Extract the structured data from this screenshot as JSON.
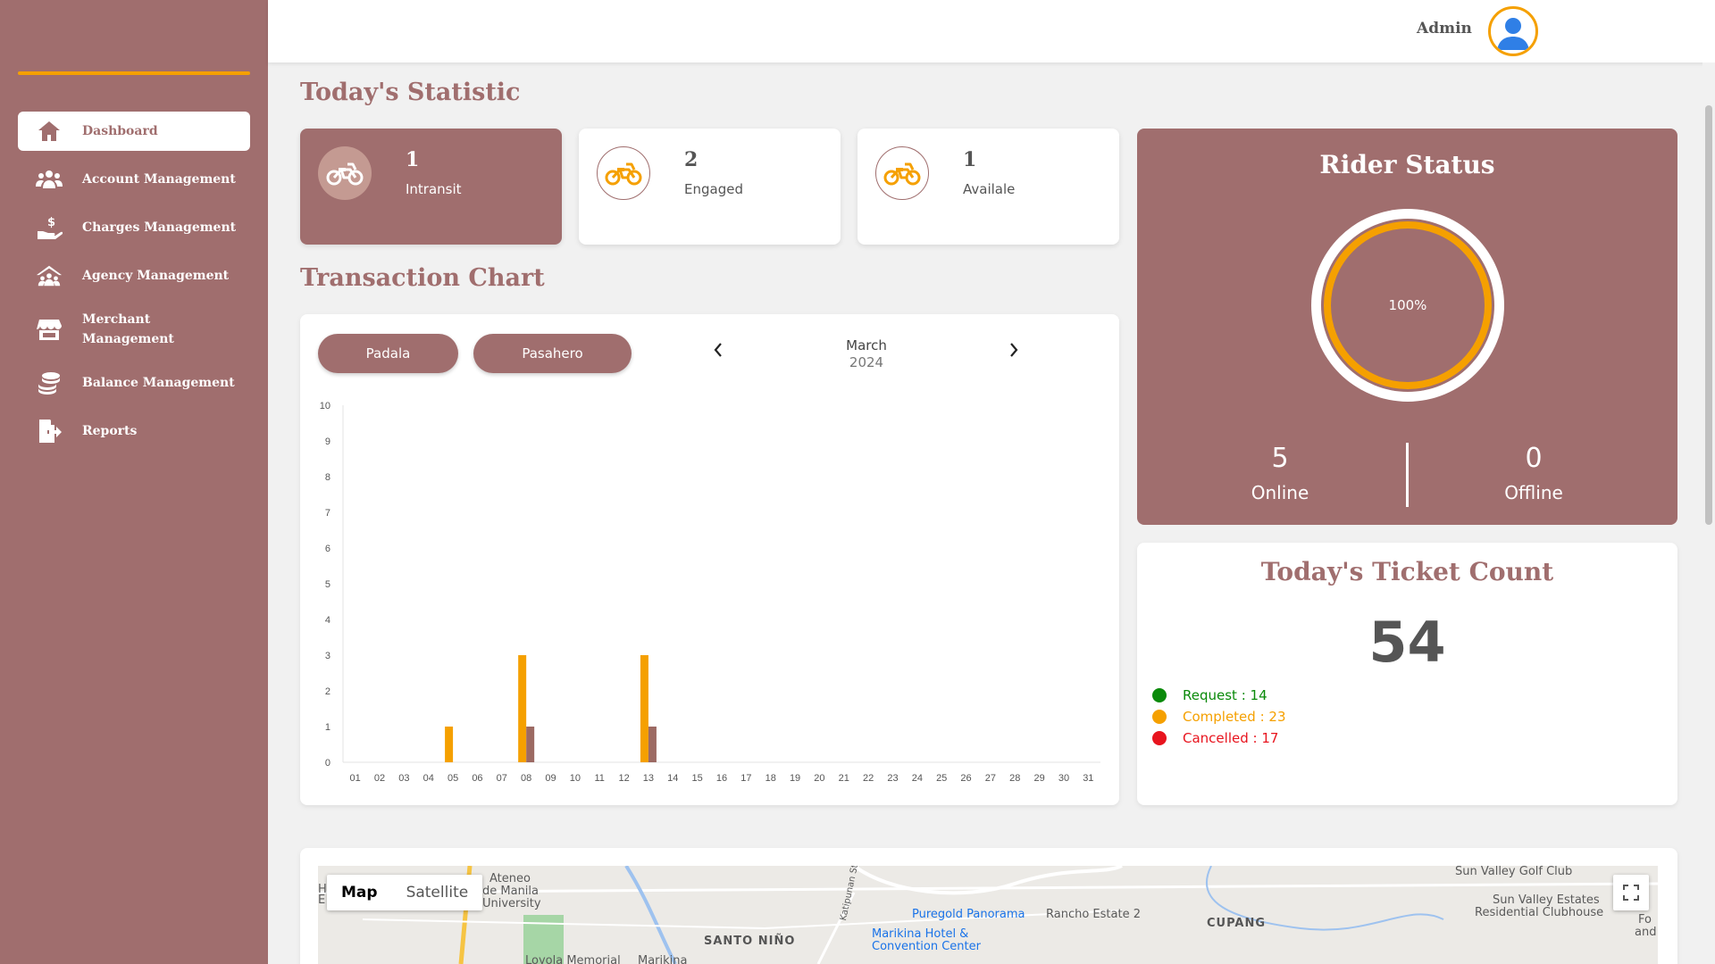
{
  "sidebar": {
    "items": [
      {
        "label": "Dashboard",
        "icon": "home-icon"
      },
      {
        "label": "Account Management",
        "icon": "users-icon"
      },
      {
        "label": "Charges Management",
        "icon": "hand-dollar-icon"
      },
      {
        "label": "Agency Management",
        "icon": "agency-icon"
      },
      {
        "label": "Merchant",
        "label2": "Management",
        "icon": "store-icon"
      },
      {
        "label": "Balance Management",
        "icon": "coins-icon"
      },
      {
        "label": "Reports",
        "icon": "file-export-icon"
      }
    ]
  },
  "header": {
    "user": "Admin"
  },
  "stats": {
    "title": "Today's Statistic",
    "cards": [
      {
        "value": "1",
        "label": "Intransit"
      },
      {
        "value": "2",
        "label": "Engaged"
      },
      {
        "value": "1",
        "label": "Availale"
      }
    ]
  },
  "transaction": {
    "title": "Transaction Chart",
    "buttons": [
      "Padala",
      "Pasahero"
    ],
    "month": "March",
    "year": "2024"
  },
  "chart_data": {
    "type": "bar",
    "categories": [
      "01",
      "02",
      "03",
      "04",
      "05",
      "06",
      "07",
      "08",
      "09",
      "10",
      "11",
      "12",
      "13",
      "14",
      "15",
      "16",
      "17",
      "18",
      "19",
      "20",
      "21",
      "22",
      "23",
      "24",
      "25",
      "26",
      "27",
      "28",
      "29",
      "30",
      "31"
    ],
    "series": [
      {
        "color": "#f5a000",
        "values": [
          0,
          0,
          0,
          0,
          1,
          0,
          0,
          3,
          0,
          0,
          0,
          0,
          3,
          0,
          0,
          0,
          0,
          0,
          0,
          0,
          0,
          0,
          0,
          0,
          0,
          0,
          0,
          0,
          0,
          0,
          0
        ]
      },
      {
        "color": "#9c6a63",
        "values": [
          0,
          0,
          0,
          0,
          0,
          0,
          0,
          1,
          0,
          0,
          0,
          0,
          1,
          0,
          0,
          0,
          0,
          0,
          0,
          0,
          0,
          0,
          0,
          0,
          0,
          0,
          0,
          0,
          0,
          0,
          0
        ]
      }
    ],
    "ylim": [
      0,
      10
    ],
    "yticks": [
      "0",
      "1",
      "2",
      "3",
      "4",
      "5",
      "6",
      "7",
      "8",
      "9",
      "10"
    ]
  },
  "rider": {
    "title": "Rider Status",
    "percent": "100%",
    "online": "5",
    "online_label": "Online",
    "offline": "0",
    "offline_label": "Offline"
  },
  "ticket": {
    "title": "Today's Ticket Count",
    "total": "54",
    "request": "Request : 14",
    "completed": "Completed : 23",
    "cancelled": "Cancelled : 17",
    "colors": {
      "request": "#0a8a0a",
      "completed": "#f5a000",
      "cancelled": "#e8141e"
    }
  },
  "map": {
    "map_btn": "Map",
    "satellite_btn": "Satellite",
    "labels": {
      "ateneo": "Ateneo",
      "ateneo2": "de Manila",
      "ateneo3": "University",
      "santo_nino": "SANTO NIÑO",
      "katipunan": "Katipunan St",
      "puregold": "Puregold Panorama",
      "marikina_hotel": "Marikina Hotel &",
      "marikina_hotel2": "Convention Center",
      "rancho": "Rancho Estate 2",
      "cupang": "CUPANG",
      "sun_valley_golf": "Sun Valley Golf Club",
      "sun_valley_estates": "Sun Valley Estates",
      "sun_valley_estates2": "Residential Clubhouse",
      "loyola": "Loyola Memorial",
      "marikina": "Marikina",
      "fo": "Fo",
      "and": "and",
      "h": "H",
      "e": "E"
    }
  }
}
